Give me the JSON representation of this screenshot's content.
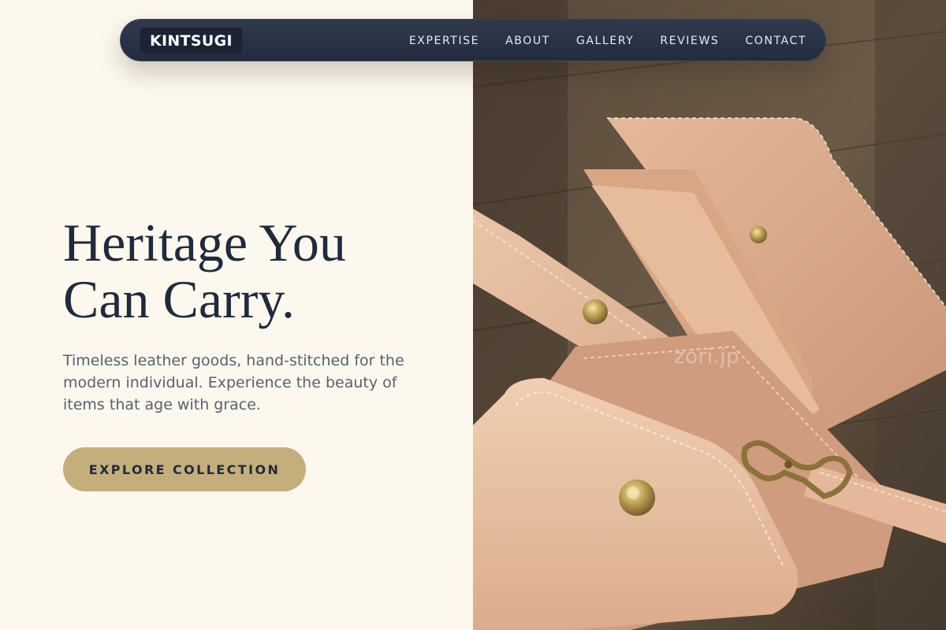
{
  "nav": {
    "logo": "KINTSUGI",
    "links": [
      "EXPERTISE",
      "ABOUT",
      "GALLERY",
      "REVIEWS",
      "CONTACT"
    ]
  },
  "hero": {
    "title_line1": "Heritage You",
    "title_line2": "Can Carry.",
    "description": "Timeless leather goods, hand-stitched for the modern individual. Experience the beauty of items that age with grace.",
    "cta_label": "EXPLORE COLLECTION"
  },
  "image": {
    "subject": "natural leather wallets and key case with brass snap and clasp on wooden tray",
    "watermark": "zori.jp"
  },
  "colors": {
    "background": "#fdf8ee",
    "navbar": "#263044",
    "heading": "#1f2a3d",
    "body_text": "#566170",
    "cta": "#c4ae7c",
    "leather": "#d9a988"
  }
}
